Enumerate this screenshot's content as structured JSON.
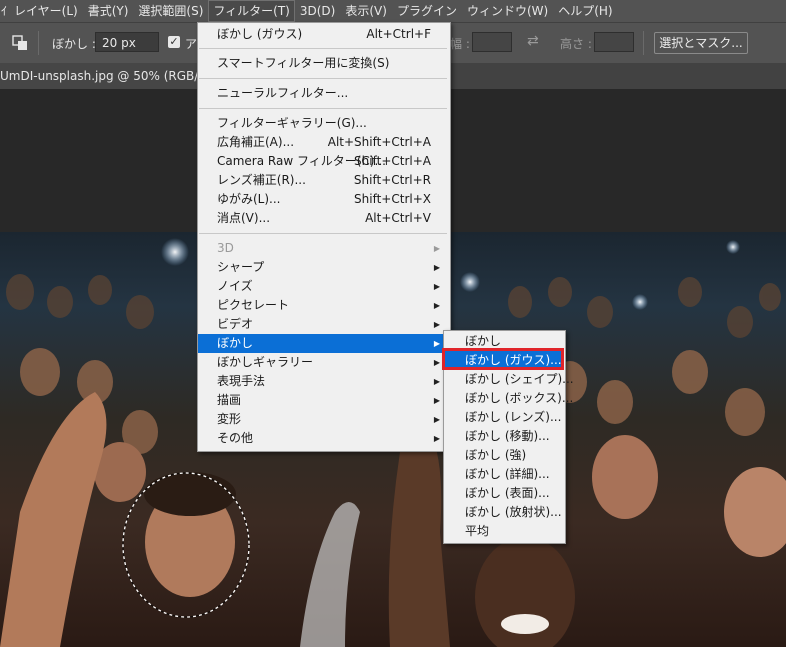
{
  "menubar": {
    "items": [
      "ｲ",
      "レイヤー(L)",
      "書式(Y)",
      "選択範囲(S)",
      "フィルター(T)",
      "3D(D)",
      "表示(V)",
      "プラグイン",
      "ウィンドウ(W)",
      "ヘルプ(H)"
    ],
    "active_index": 4
  },
  "options": {
    "feather_label": "ぼかし :",
    "feather_value": "20 px",
    "antialias_label": "ア",
    "width_label": "幅 :",
    "height_label": "高さ :",
    "select_mask_button": "選択とマスク..."
  },
  "document": {
    "tab_title": "UmDI-unsplash.jpg @ 50% (RGB/8) *"
  },
  "filter_menu": {
    "groups": [
      [
        {
          "label": "ぼかし (ガウス)",
          "shortcut": "Alt+Ctrl+F"
        }
      ],
      [
        {
          "label": "スマートフィルター用に変換(S)",
          "shortcut": ""
        }
      ],
      [
        {
          "label": "ニューラルフィルター...",
          "shortcut": ""
        }
      ],
      [
        {
          "label": "フィルターギャラリー(G)...",
          "shortcut": ""
        },
        {
          "label": "広角補正(A)...",
          "shortcut": "Alt+Shift+Ctrl+A"
        },
        {
          "label": "Camera Raw フィルター(C)...",
          "shortcut": "Shift+Ctrl+A"
        },
        {
          "label": "レンズ補正(R)...",
          "shortcut": "Shift+Ctrl+R"
        },
        {
          "label": "ゆがみ(L)...",
          "shortcut": "Shift+Ctrl+X"
        },
        {
          "label": "消点(V)...",
          "shortcut": "Alt+Ctrl+V"
        }
      ],
      [
        {
          "label": "3D",
          "submenu": true,
          "disabled": true
        },
        {
          "label": "シャープ",
          "submenu": true
        },
        {
          "label": "ノイズ",
          "submenu": true
        },
        {
          "label": "ピクセレート",
          "submenu": true
        },
        {
          "label": "ビデオ",
          "submenu": true
        },
        {
          "label": "ぼかし",
          "submenu": true,
          "highlighted": true
        },
        {
          "label": "ぼかしギャラリー",
          "submenu": true
        },
        {
          "label": "表現手法",
          "submenu": true
        },
        {
          "label": "描画",
          "submenu": true
        },
        {
          "label": "変形",
          "submenu": true
        },
        {
          "label": "その他",
          "submenu": true
        }
      ]
    ]
  },
  "blur_submenu": {
    "items": [
      {
        "label": "ぼかし"
      },
      {
        "label": "ぼかし (ガウス)...",
        "highlighted": true
      },
      {
        "label": "ぼかし (シェイプ)..."
      },
      {
        "label": "ぼかし (ボックス)..."
      },
      {
        "label": "ぼかし (レンズ)..."
      },
      {
        "label": "ぼかし (移動)..."
      },
      {
        "label": "ぼかし (強)"
      },
      {
        "label": "ぼかし (詳細)..."
      },
      {
        "label": "ぼかし (表面)..."
      },
      {
        "label": "ぼかし (放射状)..."
      },
      {
        "label": "平均"
      }
    ]
  },
  "colors": {
    "menubar_bg": "#535353",
    "menu_bg": "#f0f0f0",
    "highlight": "#0b6fd6",
    "annotation_box": "#e0242a"
  }
}
